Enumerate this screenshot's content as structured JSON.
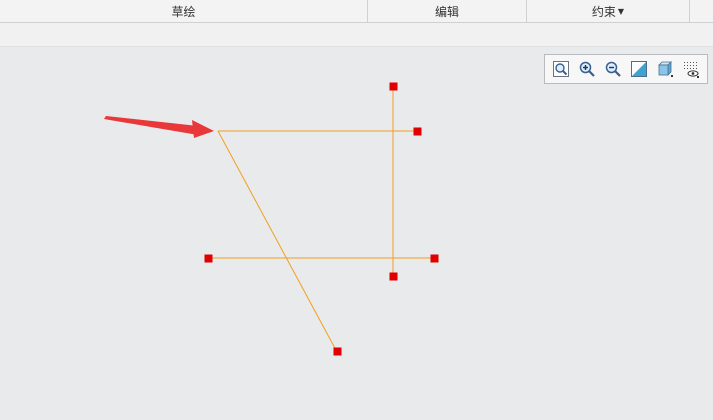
{
  "ribbon": {
    "sketch_label": "草绘",
    "edit_label": "编辑",
    "constraint_label": "约束"
  },
  "view_toolbar": {
    "icons": [
      "refit-icon",
      "zoom-in-icon",
      "zoom-out-icon",
      "repaint-icon",
      "display-style-icon",
      "sketcher-display-filter-icon"
    ]
  },
  "colors": {
    "sketch_line": "#f0a020",
    "endpoint": "#e00000",
    "arrow": "#e8383a"
  }
}
